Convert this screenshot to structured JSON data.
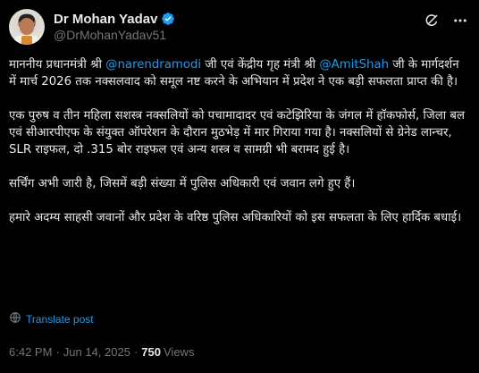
{
  "author": {
    "display_name": "Dr Mohan Yadav",
    "handle": "@DrMohanYadav51"
  },
  "icons": {
    "verified": "verified-badge-icon",
    "grok": "grok-icon",
    "more": "more-options-icon",
    "translate": "globe-icon"
  },
  "colors": {
    "background": "#000000",
    "text": "#e7e9ea",
    "muted": "#71767b",
    "link": "#1d9bf0"
  },
  "post": {
    "p1_a": "माननीय प्रधानमंत्री श्री ",
    "mention1": "@narendramodi",
    "p1_b": " जी एवं केंद्रीय गृह मंत्री श्री ",
    "mention2": "@AmitShah",
    "p1_c": " जी के मार्गदर्शन में मार्च 2026 तक नक्सलवाद को समूल नष्ट करने के अभियान में प्रदेश ने एक बड़ी सफलता प्राप्त की है।",
    "p2": "एक पुरुष व तीन महिला सशस्त्र नक्सलियों को पचामादादर एवं कटेझिरिया के जंगल में हॉकफोर्स, जिला बल एवं सीआरपीएफ के संयुक्त ऑपरेशन के दौरान मुठभेड़ में मार गिराया गया है। नक्सलियों से ग्रेनेड लान्चर, SLR राइफल, दो .315 बोर राइफल एवं अन्य शस्त्र व सामग्री भी बरामद हुई है।",
    "p3": "सर्चिंग अभी जारी है, जिसमें बड़ी संख्या में पुलिस अधिकारी एवं जवान लगे हुए हैं।",
    "p4": "हमारे अदम्य साहसी जवानों और प्रदेश के वरिष्ठ  पुलिस अधिकारियों को इस सफलता के लिए हार्दिक बधाई।"
  },
  "translate_label": "Translate post",
  "meta": {
    "time": "6:42 PM",
    "date": "Jun 14, 2025",
    "views_count": "750",
    "views_label": "Views"
  }
}
